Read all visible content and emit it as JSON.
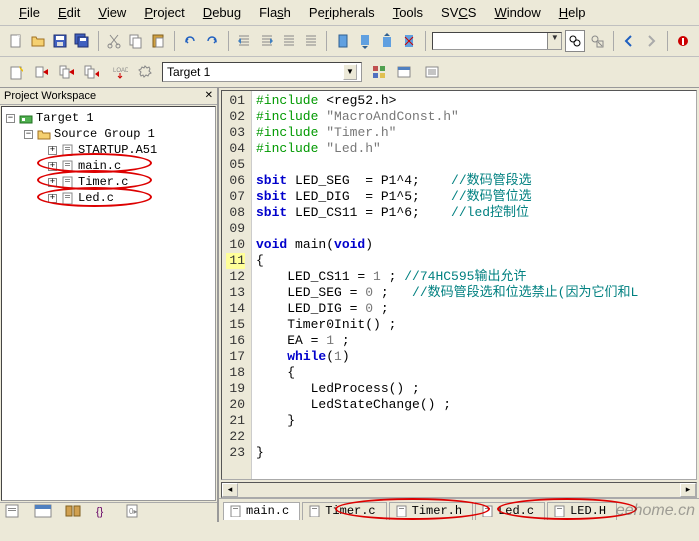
{
  "menus": [
    "File",
    "Edit",
    "View",
    "Project",
    "Debug",
    "Flash",
    "Peripherals",
    "Tools",
    "SVCS",
    "Window",
    "Help"
  ],
  "menu_underline_idx": [
    0,
    0,
    0,
    0,
    0,
    3,
    2,
    0,
    2,
    0,
    0
  ],
  "target_dropdown": "Target 1",
  "workspace_title": "Project Workspace",
  "tree": {
    "root": "Target 1",
    "group": "Source Group 1",
    "files": [
      "STARTUP.A51",
      "main.c",
      "Timer.c",
      "Led.c"
    ]
  },
  "code_lines": [
    {
      "n": "01",
      "html": "<span class='pp'>#include</span> &lt;reg52.h&gt;"
    },
    {
      "n": "02",
      "html": "<span class='pp'>#include</span> <span class='str'>\"MacroAndConst.h\"</span>"
    },
    {
      "n": "03",
      "html": "<span class='pp'>#include</span> <span class='str'>\"Timer.h\"</span>"
    },
    {
      "n": "04",
      "html": "<span class='pp'>#include</span> <span class='str'>\"Led.h\"</span>"
    },
    {
      "n": "05",
      "html": ""
    },
    {
      "n": "06",
      "html": "<span class='kw'>sbit</span> LED_SEG  = P1^4;    <span class='cmt'>//数码管段选</span>"
    },
    {
      "n": "07",
      "html": "<span class='kw'>sbit</span> LED_DIG  = P1^5;    <span class='cmt'>//数码管位选</span>"
    },
    {
      "n": "08",
      "html": "<span class='kw'>sbit</span> LED_CS11 = P1^6;    <span class='cmt'>//led控制位</span>"
    },
    {
      "n": "09",
      "html": ""
    },
    {
      "n": "10",
      "html": "<span class='kw'>void</span> main(<span class='kw'>void</span>)"
    },
    {
      "n": "11",
      "html": "{"
    },
    {
      "n": "12",
      "html": "    LED_CS11 = <span class='num'>1</span> ; <span class='cmt'>//74HC595输出允许</span>"
    },
    {
      "n": "13",
      "html": "    LED_SEG = <span class='num'>0</span> ;   <span class='cmt'>//数码管段选和位选禁止(因为它们和L</span>"
    },
    {
      "n": "14",
      "html": "    LED_DIG = <span class='num'>0</span> ;"
    },
    {
      "n": "15",
      "html": "    Timer0Init() ;"
    },
    {
      "n": "16",
      "html": "    EA = <span class='num'>1</span> ;"
    },
    {
      "n": "17",
      "html": "    <span class='kw'>while</span>(<span class='num'>1</span>)"
    },
    {
      "n": "18",
      "html": "    {"
    },
    {
      "n": "19",
      "html": "       LedProcess() ;"
    },
    {
      "n": "20",
      "html": "       LedStateChange() ;"
    },
    {
      "n": "21",
      "html": "    }"
    },
    {
      "n": "22",
      "html": ""
    },
    {
      "n": "23",
      "html": "}"
    }
  ],
  "current_line": "11",
  "editor_tabs": [
    "main.c",
    "Timer.c",
    "Timer.h",
    "Led.c",
    "LED.H"
  ],
  "active_tab": 0,
  "watermark": "eehome.cn"
}
